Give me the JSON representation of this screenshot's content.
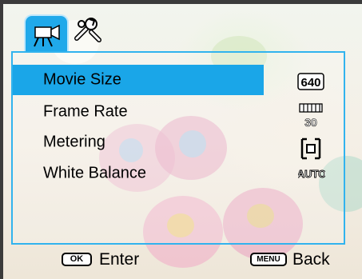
{
  "tabs": [
    {
      "name": "movie",
      "icon": "movie-camera-icon",
      "selected": true
    },
    {
      "name": "setup",
      "icon": "tools-icon",
      "selected": false
    }
  ],
  "menu": {
    "items": [
      {
        "label": "Movie Size",
        "value_icon": "640",
        "selected": true
      },
      {
        "label": "Frame Rate",
        "value_icon": "30",
        "selected": false
      },
      {
        "label": "Metering",
        "value_icon": "center-metering-icon",
        "selected": false
      },
      {
        "label": "White Balance",
        "value_icon": "AUTO",
        "selected": false
      }
    ]
  },
  "footer": {
    "ok_key": "OK",
    "ok_label": "Enter",
    "menu_key": "MENU",
    "menu_label": "Back"
  },
  "colors": {
    "accent": "#1aa6e8",
    "frame": "#3b3b3b"
  }
}
